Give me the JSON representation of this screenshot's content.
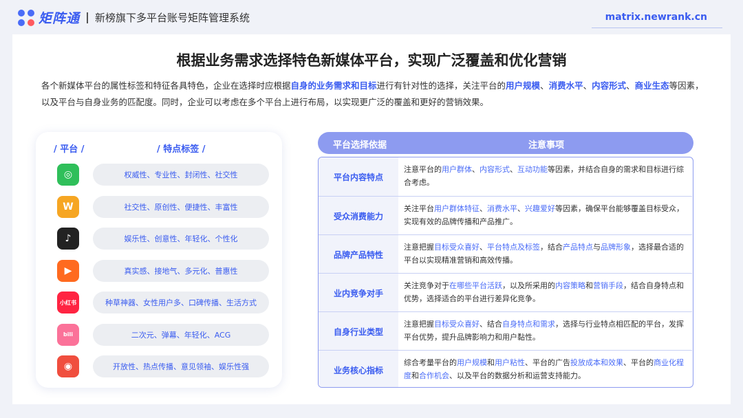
{
  "header": {
    "brand": "矩阵通",
    "title": "新榜旗下多平台账号矩阵管理系统",
    "url": "matrix.newrank.cn"
  },
  "main": {
    "headline": "根据业务需求选择特色新媒体平台，实现广泛覆盖和优化营销",
    "intro": [
      {
        "t": "各个新媒体平台的属性标签和特征各具特色，企业在选择时应根据",
        "h": false
      },
      {
        "t": "自身的业务需求和目标",
        "h": true
      },
      {
        "t": "进行有针对性的选择，关注平台的",
        "h": false
      },
      {
        "t": "用户规模",
        "h": true
      },
      {
        "t": "、",
        "h": false
      },
      {
        "t": "消费水平",
        "h": true
      },
      {
        "t": "、",
        "h": false
      },
      {
        "t": "内容形式",
        "h": true
      },
      {
        "t": "、",
        "h": false
      },
      {
        "t": "商业生态",
        "h": true
      },
      {
        "t": "等因素，以及平台与自身业务的匹配度。同时，企业可以考虑在多个平台上进行布局，以实现更广泛的覆盖和更好的营销效果。",
        "h": false
      }
    ]
  },
  "platforms": {
    "col1": "/ 平台 /",
    "col2": "/ 特点标签 /",
    "rows": [
      {
        "icon": "wechat-channels-icon",
        "glyph": "◎",
        "color": "#2fbf5a",
        "tags": "权威性、专业性、封闭性、社交性"
      },
      {
        "icon": "wechat-official-icon",
        "glyph": "W",
        "color": "#f6a623",
        "tags": "社交性、原创性、便捷性、丰富性"
      },
      {
        "icon": "douyin-icon",
        "glyph": "♪",
        "color": "#222222",
        "tags": "娱乐性、创意性、年轻化、个性化"
      },
      {
        "icon": "kuaishou-icon",
        "glyph": "▶",
        "color": "#ff6a1f",
        "tags": "真实感、接地气、多元化、普惠性"
      },
      {
        "icon": "xiaohongshu-icon",
        "glyph": "小红书",
        "color": "#ff2442",
        "tags": "种草神器、女性用户多、口碑传播、生活方式"
      },
      {
        "icon": "bilibili-icon",
        "glyph": "bili",
        "color": "#fb7299",
        "tags": "二次元、弹幕、年轻化、ACG"
      },
      {
        "icon": "weibo-icon",
        "glyph": "◉",
        "color": "#f04e3e",
        "tags": "开放性、热点传播、意见领袖、娱乐性强"
      }
    ]
  },
  "table": {
    "head_left": "平台选择依据",
    "head_right": "注意事项",
    "rows": [
      {
        "key": "平台内容特点",
        "val": [
          {
            "t": "注意平台的",
            "h": false
          },
          {
            "t": "用户群体",
            "h": true
          },
          {
            "t": "、",
            "h": false
          },
          {
            "t": "内容形式",
            "h": true
          },
          {
            "t": "、",
            "h": false
          },
          {
            "t": "互动功能",
            "h": true
          },
          {
            "t": "等因素，并结合自身的需求和目标进行综合考虑。",
            "h": false
          }
        ]
      },
      {
        "key": "受众消费能力",
        "val": [
          {
            "t": "关注平台",
            "h": false
          },
          {
            "t": "用户群体特征",
            "h": true
          },
          {
            "t": "、",
            "h": false
          },
          {
            "t": "消费水平",
            "h": true
          },
          {
            "t": "、",
            "h": false
          },
          {
            "t": "兴趣爱好",
            "h": true
          },
          {
            "t": "等因素，确保平台能够覆盖目标受众，实现有效的品牌传播和产品推广。",
            "h": false
          }
        ]
      },
      {
        "key": "品牌产品特性",
        "val": [
          {
            "t": "注意把握",
            "h": false
          },
          {
            "t": "目标受众喜好",
            "h": true
          },
          {
            "t": "、",
            "h": false
          },
          {
            "t": "平台特点及标签",
            "h": true
          },
          {
            "t": "，结合",
            "h": false
          },
          {
            "t": "产品特点",
            "h": true
          },
          {
            "t": "与",
            "h": false
          },
          {
            "t": "品牌形象",
            "h": true
          },
          {
            "t": "，选择最合适的平台以实现精准营销和高效传播。",
            "h": false
          }
        ]
      },
      {
        "key": "业内竞争对手",
        "val": [
          {
            "t": "关注竞争对于",
            "h": false
          },
          {
            "t": "在哪些平台活跃",
            "h": true
          },
          {
            "t": "，以及所采用的",
            "h": false
          },
          {
            "t": "内容策略",
            "h": true
          },
          {
            "t": "和",
            "h": false
          },
          {
            "t": "营销手段",
            "h": true
          },
          {
            "t": "，结合自身特点和优势，选择适合的平台进行差异化竞争。",
            "h": false
          }
        ]
      },
      {
        "key": "自身行业类型",
        "val": [
          {
            "t": "注意把握",
            "h": false
          },
          {
            "t": "目标受众喜好",
            "h": true
          },
          {
            "t": "、结合",
            "h": false
          },
          {
            "t": "自身特点和需求",
            "h": true
          },
          {
            "t": "，选择与行业特点相匹配的平台，发挥平台优势，提升品牌影响力和用户黏性。",
            "h": false
          }
        ]
      },
      {
        "key": "业务核心指标",
        "val": [
          {
            "t": "综合考量平台的",
            "h": false
          },
          {
            "t": "用户规模",
            "h": true
          },
          {
            "t": "和",
            "h": false
          },
          {
            "t": "用户粘性",
            "h": true
          },
          {
            "t": "、平台的广告",
            "h": false
          },
          {
            "t": "投放成本和效果",
            "h": true
          },
          {
            "t": "、平台的",
            "h": false
          },
          {
            "t": "商业化程度",
            "h": true
          },
          {
            "t": "和",
            "h": false
          },
          {
            "t": "合作机会",
            "h": true
          },
          {
            "t": "、以及平台的数据分析和运营支持能力。",
            "h": false
          }
        ]
      }
    ]
  }
}
